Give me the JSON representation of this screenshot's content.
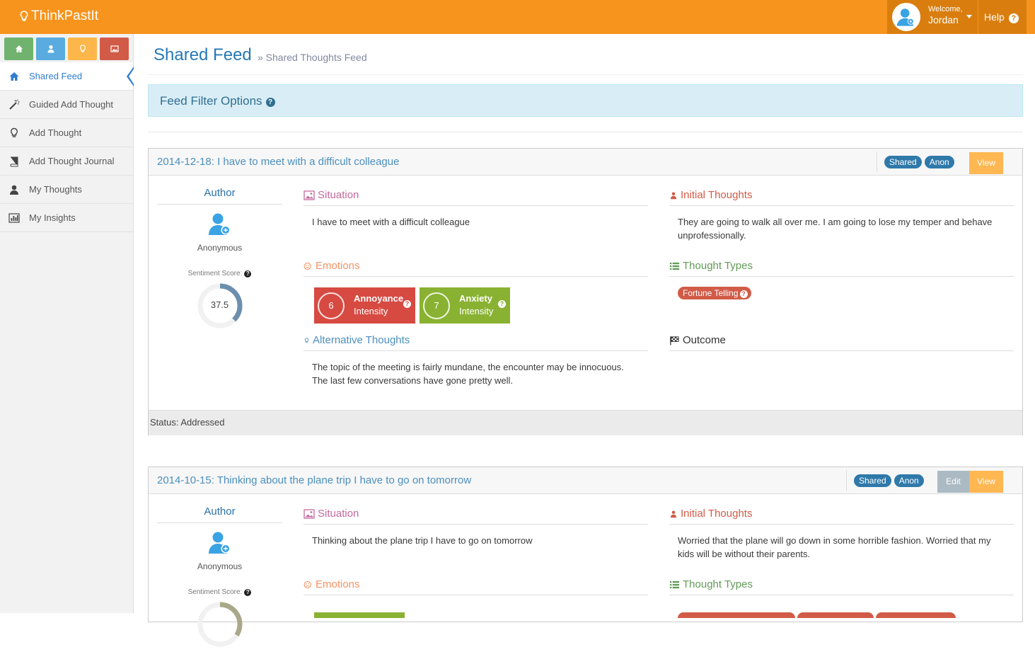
{
  "app": {
    "brand": "ThinkPastIt"
  },
  "user": {
    "welcome": "Welcome,",
    "name": "Jordan"
  },
  "help_label": "Help",
  "help_glyph": "?",
  "shortcuts": [
    {
      "icon": "home-icon",
      "color": "#6fb36f"
    },
    {
      "icon": "user-icon",
      "color": "#5aabe0"
    },
    {
      "icon": "lightbulb-icon",
      "color": "#fcb64a"
    },
    {
      "icon": "image-icon",
      "color": "#d15b47"
    }
  ],
  "sidebar": {
    "items": [
      {
        "label": "Shared Feed",
        "icon": "home-icon",
        "active": true
      },
      {
        "label": "Guided Add Thought",
        "icon": "magic-wand-icon"
      },
      {
        "label": "Add Thought",
        "icon": "lightbulb-icon"
      },
      {
        "label": "Add Thought Journal",
        "icon": "book-icon"
      },
      {
        "label": "My Thoughts",
        "icon": "user-icon"
      },
      {
        "label": "My Insights",
        "icon": "bar-chart-icon"
      }
    ]
  },
  "page": {
    "title": "Shared Feed",
    "breadcrumb": "» Shared Thoughts Feed"
  },
  "filter": {
    "label": "Feed Filter Options",
    "glyph": "?"
  },
  "labels": {
    "author": "Author",
    "anonymous": "Anonymous",
    "sentiment": "Sentiment Score:",
    "situation": "Situation",
    "initial_thoughts": "Initial Thoughts",
    "emotions": "Emotions",
    "thought_types": "Thought Types",
    "alternative_thoughts": "Alternative Thoughts",
    "outcome": "Outcome",
    "intensity": "Intensity",
    "shared": "Shared",
    "anon": "Anon",
    "edit": "Edit",
    "view": "View",
    "q": "?"
  },
  "cards": [
    {
      "title": "2014-12-18: I have to meet with a difficult colleague",
      "sentiment": "37.5",
      "sentiment_fraction": 0.375,
      "situation": "I have to meet with a difficult colleague",
      "initial_thoughts": "They are going to walk all over me. I am going to lose my temper and behave unprofessionally.",
      "emotions": [
        {
          "name": "Annoyance",
          "value": "6",
          "color": "#d64a42"
        },
        {
          "name": "Anxiety",
          "value": "7",
          "color": "#8ab232"
        }
      ],
      "thought_types": [
        "Fortune Telling"
      ],
      "alternative_thoughts": "The topic of the meeting is fairly mundane, the encounter may be innocuous. The last few conversations have gone pretty well.",
      "status": "Status: Addressed"
    },
    {
      "title": "2014-10-15: Thinking about the plane trip I have to go on tomorrow",
      "situation": "Thinking about the plane trip I have to go on tomorrow",
      "initial_thoughts": "Worried that the plane will go down in some horrible fashion. Worried that my kids will be without their parents."
    }
  ]
}
